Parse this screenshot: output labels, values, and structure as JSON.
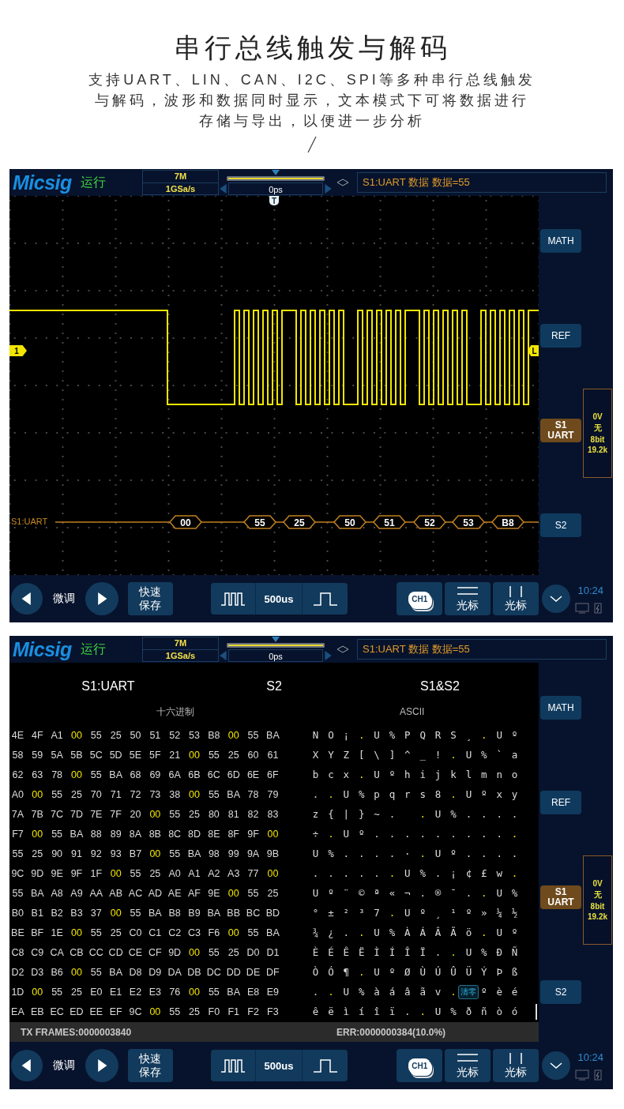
{
  "headline": "串行总线触发与解码",
  "description": "支持UART、LIN、CAN、I2C、SPI等多种串行总线触发与解码，波形和数据同时显示，文本模式下可将数据进行存储与导出，以便进一步分析",
  "screens": [
    {
      "kind": "waveform",
      "header": {
        "logo": "Micsig",
        "run_state": "运行",
        "memory_depth": "7M",
        "sample_rate": "1GSa/s",
        "time_offset": "0ps",
        "trigger_info": "S1:UART 数据 数据=55"
      },
      "side_buttons": [
        {
          "label": "MATH",
          "selected": false
        },
        {
          "label": "REF",
          "selected": false
        },
        {
          "label": "S1",
          "sublabel": "UART",
          "selected": true
        },
        {
          "label": "S2",
          "selected": false
        }
      ],
      "bus_settings": [
        "0V",
        "无",
        "8bit",
        "19.2k"
      ],
      "bottom_bar": {
        "fine_tune": "微调",
        "quick_save": "快速保存",
        "timebase": "500us",
        "channel": "CH1",
        "cursor_buttons": [
          "光标",
          "光标"
        ],
        "clock": "10:24"
      },
      "plot": {
        "trigger_marker": "T",
        "channel_marker": "1",
        "level_marker": "L",
        "bus_label": "S1:UART",
        "bus_bytes": [
          "00",
          "55",
          "25",
          "50",
          "51",
          "52",
          "53",
          "B8"
        ]
      }
    },
    {
      "kind": "table",
      "header": {
        "logo": "Micsig",
        "run_state": "运行",
        "memory_depth": "7M",
        "sample_rate": "1GSa/s",
        "time_offset": "0ps",
        "trigger_info": "S1:UART 数据 数据=55"
      },
      "side_buttons": [
        {
          "label": "MATH",
          "selected": false
        },
        {
          "label": "REF",
          "selected": false
        },
        {
          "label": "S1",
          "sublabel": "UART",
          "selected": true
        },
        {
          "label": "S2",
          "selected": false
        }
      ],
      "bus_settings": [
        "0V",
        "无",
        "8bit",
        "19.2k"
      ],
      "bottom_bar": {
        "fine_tune": "微调",
        "quick_save": "快速保存",
        "timebase": "500us",
        "channel": "CH1",
        "cursor_buttons": [
          "光标",
          "光标"
        ],
        "clock": "10:24"
      },
      "tabs": [
        "S1:UART",
        "S2",
        "S1&S2"
      ],
      "hex_heading": "十六进制",
      "ascii_heading": "ASCII",
      "rows": [
        {
          "hex": [
            "4E",
            "4F",
            "A1",
            {
              "text": "00",
              "highlighted": true
            },
            "55",
            "25",
            "50",
            "51",
            "52",
            "53",
            "B8",
            {
              "text": "00",
              "highlighted": true
            },
            "55",
            "BA"
          ],
          "ascii": [
            "N",
            "O",
            "¡",
            {
              "text": ".",
              "highlighted": true
            },
            "U",
            "%",
            "P",
            "Q",
            "R",
            "S",
            "¸",
            {
              "text": ".",
              "highlighted": true
            },
            "U",
            "º"
          ]
        },
        {
          "hex": [
            "58",
            "59",
            "5A",
            "5B",
            "5C",
            "5D",
            "5E",
            "5F",
            "21",
            {
              "text": "00",
              "highlighted": true
            },
            "55",
            "25",
            "60",
            "61"
          ],
          "ascii": [
            "X",
            "Y",
            "Z",
            "[",
            "\\",
            "]",
            "^",
            "_",
            "!",
            {
              "text": ".",
              "highlighted": true
            },
            "U",
            "%",
            "`",
            "a"
          ]
        },
        {
          "hex": [
            "62",
            "63",
            "78",
            {
              "text": "00",
              "highlighted": true
            },
            "55",
            "BA",
            "68",
            "69",
            "6A",
            "6B",
            "6C",
            "6D",
            "6E",
            "6F"
          ],
          "ascii": [
            "b",
            "c",
            "x",
            {
              "text": ".",
              "highlighted": true
            },
            "U",
            "º",
            "h",
            "i",
            "j",
            "k",
            "l",
            "m",
            "n",
            "o"
          ]
        },
        {
          "hex": [
            "A0",
            {
              "text": "00",
              "highlighted": true
            },
            "55",
            "25",
            "70",
            "71",
            "72",
            "73",
            "38",
            {
              "text": "00",
              "highlighted": true
            },
            "55",
            "BA",
            "78",
            "79"
          ],
          "ascii": [
            ".",
            {
              "text": ".",
              "highlighted": true
            },
            "U",
            "%",
            "p",
            "q",
            "r",
            "s",
            "8",
            {
              "text": ".",
              "highlighted": true
            },
            "U",
            "º",
            "x",
            "y"
          ]
        },
        {
          "hex": [
            "7A",
            "7B",
            "7C",
            "7D",
            "7E",
            "7F",
            "20",
            {
              "text": "00",
              "highlighted": true
            },
            "55",
            "25",
            "80",
            "81",
            "82",
            "83"
          ],
          "ascii": [
            "z",
            "{",
            "|",
            "}",
            "~",
            ".",
            {
              "kind": "blank"
            },
            {
              "text": ".",
              "highlighted": true
            },
            "U",
            "%",
            ".",
            ".",
            ".",
            "."
          ]
        },
        {
          "hex": [
            "F7",
            {
              "text": "00",
              "highlighted": true
            },
            "55",
            "BA",
            "88",
            "89",
            "8A",
            "8B",
            "8C",
            "8D",
            "8E",
            "8F",
            "9F",
            {
              "text": "00",
              "highlighted": true
            }
          ],
          "ascii": [
            "÷",
            {
              "text": ".",
              "highlighted": true
            },
            "U",
            "º",
            ".",
            ".",
            ".",
            ".",
            ".",
            ".",
            ".",
            ".",
            ".",
            {
              "text": ".",
              "highlighted": true
            }
          ]
        },
        {
          "hex": [
            "55",
            "25",
            "90",
            "91",
            "92",
            "93",
            "B7",
            {
              "text": "00",
              "highlighted": true
            },
            "55",
            "BA",
            "98",
            "99",
            "9A",
            "9B"
          ],
          "ascii": [
            "U",
            "%",
            ".",
            ".",
            ".",
            ".",
            "·",
            {
              "text": ".",
              "highlighted": true
            },
            "U",
            "º",
            ".",
            ".",
            ".",
            "."
          ]
        },
        {
          "hex": [
            "9C",
            "9D",
            "9E",
            "9F",
            "1F",
            {
              "text": "00",
              "highlighted": true
            },
            "55",
            "25",
            "A0",
            "A1",
            "A2",
            "A3",
            "77",
            {
              "text": "00",
              "highlighted": true
            }
          ],
          "ascii": [
            ".",
            ".",
            ".",
            ".",
            ".",
            {
              "text": ".",
              "highlighted": true
            },
            "U",
            "%",
            ".",
            "¡",
            "¢",
            "£",
            "w",
            {
              "text": ".",
              "highlighted": true
            }
          ]
        },
        {
          "hex": [
            "55",
            "BA",
            "A8",
            "A9",
            "AA",
            "AB",
            "AC",
            "AD",
            "AE",
            "AF",
            "9E",
            {
              "text": "00",
              "highlighted": true
            },
            "55",
            "25"
          ],
          "ascii": [
            "U",
            "º",
            "¨",
            "©",
            "ª",
            "«",
            "¬",
            ".",
            "®",
            "¯",
            ".",
            {
              "text": ".",
              "highlighted": true
            },
            "U",
            "%"
          ]
        },
        {
          "hex": [
            "B0",
            "B1",
            "B2",
            "B3",
            "37",
            {
              "text": "00",
              "highlighted": true
            },
            "55",
            "BA",
            "B8",
            "B9",
            "BA",
            "BB",
            "BC",
            "BD"
          ],
          "ascii": [
            "°",
            "±",
            "²",
            "³",
            "7",
            {
              "text": ".",
              "highlighted": true
            },
            "U",
            "º",
            "¸",
            "¹",
            "º",
            "»",
            "¼",
            "½"
          ]
        },
        {
          "hex": [
            "BE",
            "BF",
            "1E",
            {
              "text": "00",
              "highlighted": true
            },
            "55",
            "25",
            "C0",
            "C1",
            "C2",
            "C3",
            "F6",
            {
              "text": "00",
              "highlighted": true
            },
            "55",
            "BA"
          ],
          "ascii": [
            "¾",
            "¿",
            ".",
            {
              "text": ".",
              "highlighted": true
            },
            "U",
            "%",
            "À",
            "Á",
            "Â",
            "Ã",
            "ö",
            {
              "text": ".",
              "highlighted": true
            },
            "U",
            "º"
          ]
        },
        {
          "hex": [
            "C8",
            "C9",
            "CA",
            "CB",
            "CC",
            "CD",
            "CE",
            "CF",
            "9D",
            {
              "text": "00",
              "highlighted": true
            },
            "55",
            "25",
            "D0",
            "D1"
          ],
          "ascii": [
            "È",
            "É",
            "Ê",
            "Ë",
            "Ì",
            "Í",
            "Î",
            "Ï",
            ".",
            {
              "text": ".",
              "highlighted": true
            },
            "U",
            "%",
            "Ð",
            "Ñ"
          ]
        },
        {
          "hex": [
            "D2",
            "D3",
            "B6",
            {
              "text": "00",
              "highlighted": true
            },
            "55",
            "BA",
            "D8",
            "D9",
            "DA",
            "DB",
            "DC",
            "DD",
            "DE",
            "DF"
          ],
          "ascii": [
            "Ò",
            "Ó",
            "¶",
            {
              "text": ".",
              "highlighted": true
            },
            "U",
            "º",
            "Ø",
            "Ù",
            "Ú",
            "Û",
            "Ü",
            "Ý",
            "Þ",
            "ß"
          ]
        },
        {
          "hex": [
            "1D",
            {
              "text": "00",
              "highlighted": true
            },
            "55",
            "25",
            "E0",
            "E1",
            "E2",
            "E3",
            "76",
            {
              "text": "00",
              "highlighted": true
            },
            "55",
            "BA",
            "E8",
            "E9"
          ],
          "ascii": [
            ".",
            {
              "text": ".",
              "highlighted": true
            },
            "U",
            "%",
            "à",
            "á",
            "â",
            "ã",
            "v",
            {
              "text": ".",
              "highlighted": true
            },
            {
              "kind": "button",
              "text": "清零"
            },
            "º",
            "è",
            "é"
          ]
        },
        {
          "hex": [
            "EA",
            "EB",
            "EC",
            "ED",
            "EE",
            "EF",
            "9C",
            {
              "text": "00",
              "highlighted": true
            },
            "55",
            "25",
            "F0",
            "F1",
            "F2",
            "F3"
          ],
          "ascii": [
            "ê",
            "ë",
            "ì",
            "í",
            "î",
            "ï",
            ".",
            {
              "text": ".",
              "highlighted": true
            },
            "U",
            "%",
            "ð",
            "ñ",
            "ò",
            "ó"
          ]
        }
      ],
      "frames": "TX FRAMES:0000003840",
      "errors": "ERR:0000000384(10.0%)"
    }
  ]
}
